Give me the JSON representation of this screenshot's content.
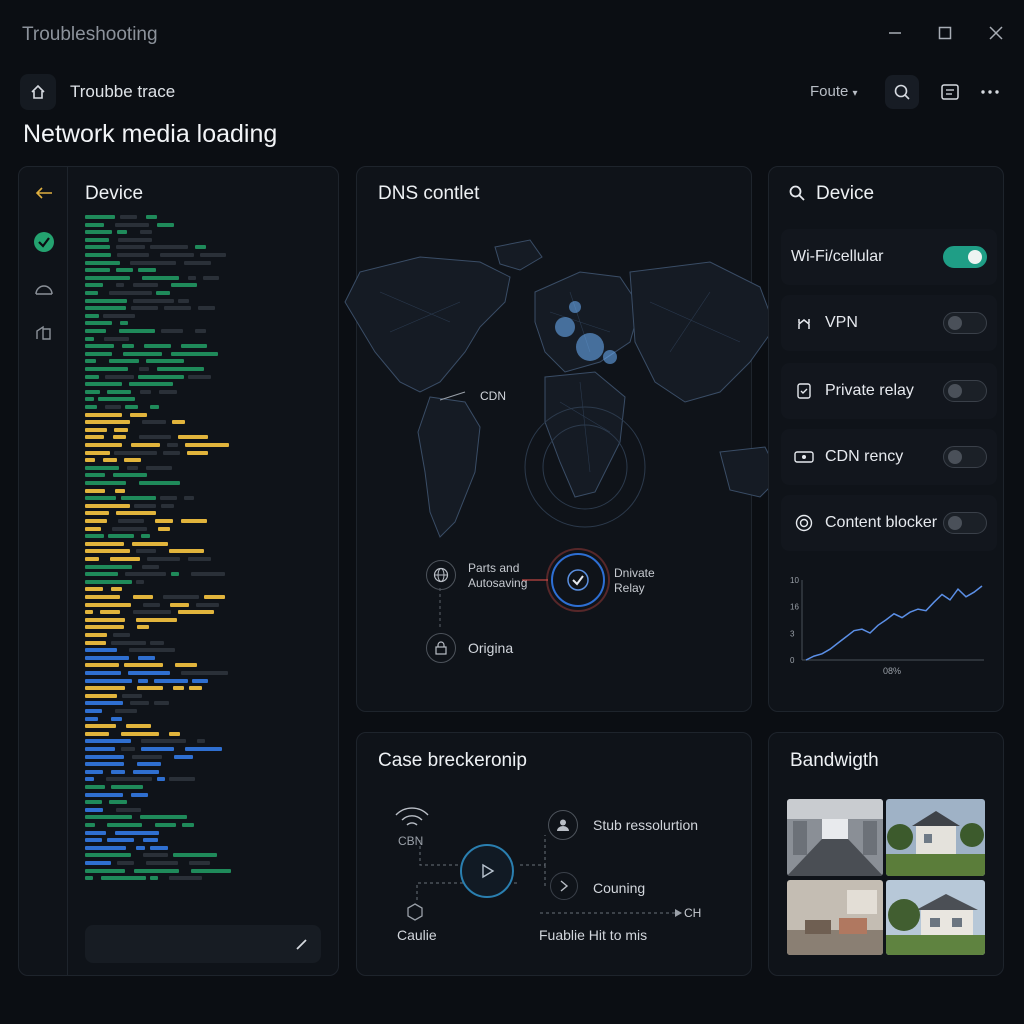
{
  "window": {
    "title": "Troubleshooting"
  },
  "toolbar": {
    "breadcrumb": "Troubbe trace",
    "route_label": "Foute",
    "route_chevron": "▾"
  },
  "page": {
    "title": "Network media loading"
  },
  "left_panel": {
    "title": "Device"
  },
  "dns_panel": {
    "title": "DNS contlet",
    "map_label": "CDN",
    "nodes": [
      {
        "label_line1": "Parts and",
        "label_line2": "Autosaving"
      },
      {
        "label_line1": "Dnivate",
        "label_line2": "Relay"
      },
      {
        "label_line1": "Origina",
        "label_line2": ""
      }
    ]
  },
  "device_panel": {
    "title": "Device",
    "settings": [
      {
        "label": "Wi-Fi/cellular",
        "icon": "wifi-icon",
        "enabled": true
      },
      {
        "label": "VPN",
        "icon": "vpn-icon",
        "enabled": false
      },
      {
        "label": "Private relay",
        "icon": "relay-icon",
        "enabled": false
      },
      {
        "label": "CDN rency",
        "icon": "cdn-icon",
        "enabled": false
      },
      {
        "label": "Content blocker",
        "icon": "blocker-icon",
        "enabled": false
      }
    ],
    "chart_data": {
      "type": "line",
      "y_ticks": [
        "10",
        "16",
        "3",
        "0"
      ],
      "x_label": "08%",
      "values": [
        0,
        5,
        8,
        14,
        22,
        30,
        38,
        40,
        35,
        45,
        52,
        60,
        55,
        62,
        66,
        64,
        75,
        85,
        78,
        92,
        82,
        88,
        96
      ]
    }
  },
  "breakdown_panel": {
    "title": "Case breckeronip",
    "cdn_label": "CBN",
    "capture_label": "Caulie",
    "stub_label": "Stub ressolurtion",
    "counting_label": "Couning",
    "hit_label": "Fuablie Hit to mis",
    "ch_label": "CH"
  },
  "bandwidth_panel": {
    "title": "Bandwigth"
  },
  "colors": {
    "accent": "#1f9e86",
    "green_log": "#1f8a5a",
    "yellow_log": "#e1b43c",
    "blue_log": "#2f6fd0"
  }
}
